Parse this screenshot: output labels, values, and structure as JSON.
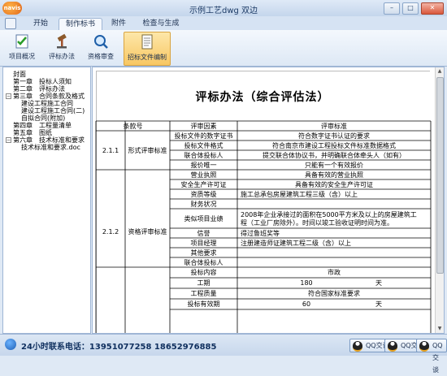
{
  "window": {
    "title": "示例工艺dwg 双边"
  },
  "app": {
    "logo_text": "navis"
  },
  "window_buttons": [
    "–",
    "□",
    "✕"
  ],
  "tabs": [
    {
      "label": "开始",
      "active": false
    },
    {
      "label": "制作标书",
      "active": true
    },
    {
      "label": "附件",
      "active": false
    },
    {
      "label": "检查与生成",
      "active": false
    }
  ],
  "ribbon": [
    {
      "label": "项目概况",
      "icon": "checklist-icon"
    },
    {
      "label": "评标办法",
      "icon": "gavel-icon"
    },
    {
      "label": "资格审查",
      "icon": "magnifier-icon"
    },
    {
      "label": "招标文件编制",
      "icon": "document-icon",
      "active": true
    }
  ],
  "tree": [
    {
      "label": "封面",
      "level": 0
    },
    {
      "label": "第一章　投标人须知",
      "level": 0
    },
    {
      "label": "第二章　评标办法",
      "level": 0
    },
    {
      "label": "第三章　合同条款及格式",
      "level": 0,
      "expanded": true
    },
    {
      "label": "建设工程施工合同",
      "level": 1
    },
    {
      "label": "建设工程施工合同(二)",
      "level": 1
    },
    {
      "label": "自拟合同(附加)",
      "level": 1
    },
    {
      "label": "第四章　工程量清单",
      "level": 0
    },
    {
      "label": "第五章　图纸",
      "level": 0
    },
    {
      "label": "第六章　技术标准和要求",
      "level": 0,
      "expanded": true
    },
    {
      "label": "技术标准和要求.doc",
      "level": 1
    }
  ],
  "document": {
    "title": "评标办法（综合评估法）",
    "headers": [
      "条款号",
      "评审因素",
      "评审标准"
    ],
    "sections": [
      {
        "no": "2.1.1",
        "name": "形式评审标准",
        "rows": [
          {
            "factor": "投标文件的数字证书",
            "standard": "符合数字证书认证的要求"
          },
          {
            "factor": "投标文件格式",
            "standard": "符合南京市建设工程投标文件标准数据格式"
          },
          {
            "factor": "联合体投标人",
            "standard": "提交联合体协议书，并明确联合体牵头人（如有）"
          },
          {
            "factor": "报价唯一",
            "standard": "只能有一个有效报价"
          }
        ]
      },
      {
        "no": "2.1.2",
        "name": "资格评审标准",
        "rows": [
          {
            "factor": "营业执照",
            "standard": "具备有效的营业执照"
          },
          {
            "factor": "安全生产许可证",
            "standard": "具备有效的安全生产许可证"
          },
          {
            "factor": "资质等级",
            "standard": "施工总承包房屋建筑工程三级（含）以上"
          },
          {
            "factor": "财务状况",
            "standard": ""
          },
          {
            "factor": "类似项目业绩",
            "standard_lines": [
              "2008年企业承接过的面积在5000平方米及以上的房屋建筑工",
              "程（工业厂房除外）。时间以竣工验收证明时间为准。"
            ]
          },
          {
            "factor": "信誉",
            "standard": "得过鲁班奖等"
          },
          {
            "factor": "项目经理",
            "standard": "注册建造师证建筑工程二级（含）以上"
          },
          {
            "factor": "其他要求",
            "standard": ""
          },
          {
            "factor": "联合体投标人",
            "standard": ""
          }
        ]
      },
      {
        "no": "",
        "name": "",
        "rows": [
          {
            "factor": "投标内容",
            "standard": "市政"
          },
          {
            "factor": "工期",
            "standard": "180",
            "unit": "天"
          },
          {
            "factor": "工程质量",
            "standard": "符合国家标准要求"
          },
          {
            "factor": "投标有效期",
            "standard": "60",
            "unit": "天"
          }
        ]
      }
    ]
  },
  "status": {
    "phone": "24小时联系电话：13951077258 18652976885",
    "qq_buttons": [
      "QQ交谈",
      "QQ交谈",
      "QQ交谈"
    ]
  }
}
